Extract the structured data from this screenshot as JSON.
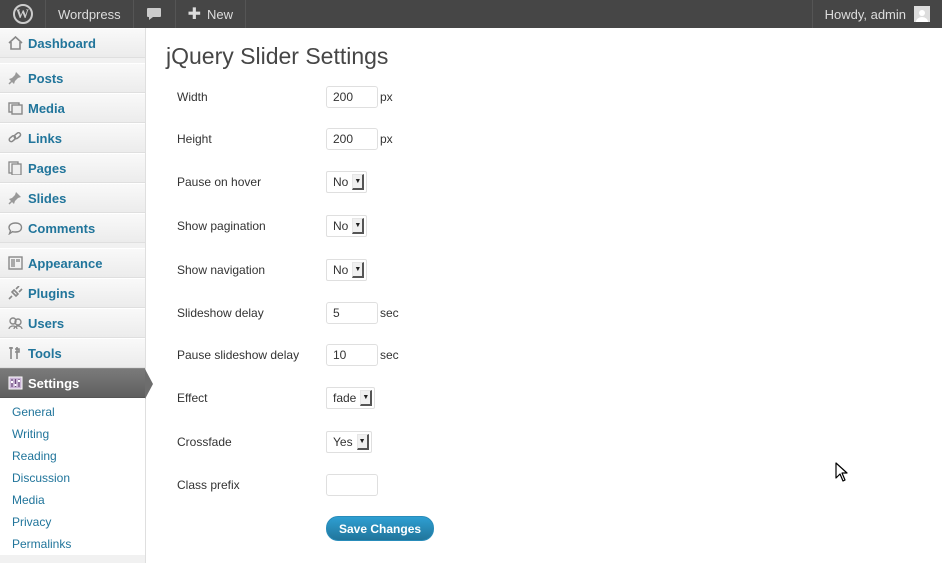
{
  "adminbar": {
    "site_name": "Wordpress",
    "new_label": "New",
    "howdy": "Howdy, admin",
    "logo_letter": "W",
    "new_icon": "plus-icon",
    "comments_icon": "comment-bubble-icon"
  },
  "sidebar": {
    "items": [
      {
        "label": "Dashboard",
        "icon": "home-icon"
      },
      {
        "label": "Posts",
        "icon": "pin-icon"
      },
      {
        "label": "Media",
        "icon": "media-icon"
      },
      {
        "label": "Links",
        "icon": "link-icon"
      },
      {
        "label": "Pages",
        "icon": "pages-icon"
      },
      {
        "label": "Slides",
        "icon": "pin-icon"
      },
      {
        "label": "Comments",
        "icon": "comment-icon"
      },
      {
        "label": "Appearance",
        "icon": "appearance-icon"
      },
      {
        "label": "Plugins",
        "icon": "plugin-icon"
      },
      {
        "label": "Users",
        "icon": "users-icon"
      },
      {
        "label": "Tools",
        "icon": "tools-icon"
      },
      {
        "label": "Settings",
        "icon": "settings-icon"
      }
    ],
    "submenu": [
      "General",
      "Writing",
      "Reading",
      "Discussion",
      "Media",
      "Privacy",
      "Permalinks"
    ]
  },
  "main": {
    "title": "jQuery Slider Settings",
    "fields": {
      "width": {
        "label": "Width",
        "value": "200",
        "unit": "px"
      },
      "height": {
        "label": "Height",
        "value": "200",
        "unit": "px"
      },
      "pause_on_hover": {
        "label": "Pause on hover",
        "value": "No"
      },
      "show_pagination": {
        "label": "Show pagination",
        "value": "No"
      },
      "show_navigation": {
        "label": "Show navigation",
        "value": "No"
      },
      "slideshow_delay": {
        "label": "Slideshow delay",
        "value": "5",
        "unit": "sec"
      },
      "pause_slideshow_delay": {
        "label": "Pause slideshow delay",
        "value": "10",
        "unit": "sec"
      },
      "effect": {
        "label": "Effect",
        "value": "fade"
      },
      "crossfade": {
        "label": "Crossfade",
        "value": "Yes"
      },
      "class_prefix": {
        "label": "Class prefix",
        "value": ""
      }
    },
    "save_label": "Save Changes"
  },
  "colors": {
    "link": "#21759b",
    "adminbar": "#464646",
    "current_menu": "#6d6d6d",
    "button": "#21759b"
  }
}
